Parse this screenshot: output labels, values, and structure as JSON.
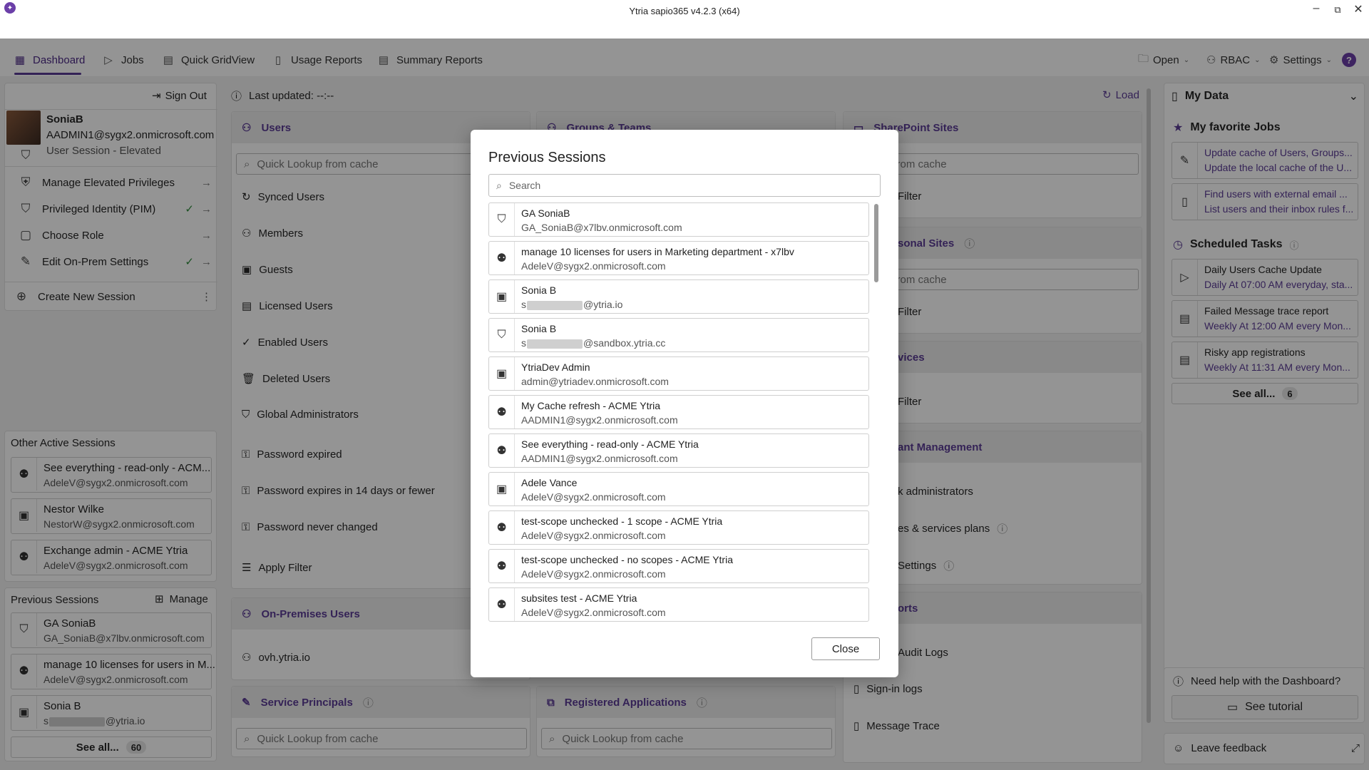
{
  "window": {
    "title": "Ytria sapio365 v4.2.3 (x64)",
    "minimize": "–",
    "restore": "⧉",
    "close": "✕"
  },
  "tabs": [
    {
      "label": "Dashboard",
      "icon": "▦"
    },
    {
      "label": "Jobs",
      "icon": "▷"
    },
    {
      "label": "Quick GridView",
      "icon": "▤"
    },
    {
      "label": "Usage Reports",
      "icon": "▯"
    },
    {
      "label": "Summary Reports",
      "icon": "▤"
    }
  ],
  "toolbar": {
    "open": "Open",
    "rbac": "RBAC",
    "settings": "Settings",
    "help": "?"
  },
  "session": {
    "sign_out": "Sign Out",
    "name": "SoniaB",
    "email": "AADMIN1@sygx2.onmicrosoft.com",
    "type": "User Session - Elevated",
    "actions": [
      {
        "label": "Manage Elevated Privileges",
        "check": false
      },
      {
        "label": "Privileged Identity (PIM)",
        "check": true
      },
      {
        "label": "Choose Role",
        "check": false
      },
      {
        "label": "Edit On-Prem Settings",
        "check": true
      }
    ],
    "create": "Create New Session"
  },
  "other_sessions": {
    "title": "Other Active Sessions",
    "items": [
      {
        "name": "See everything - read-only - ACM...",
        "email": "AdeleV@sygx2.onmicrosoft.com"
      },
      {
        "name": "Nestor Wilke",
        "email": "NestorW@sygx2.onmicrosoft.com"
      },
      {
        "name": "Exchange admin - ACME Ytria",
        "email": "AdeleV@sygx2.onmicrosoft.com"
      }
    ]
  },
  "prev_sessions_side": {
    "title": "Previous Sessions",
    "manage": "Manage",
    "items": [
      {
        "name": "GA SoniaB",
        "email": "GA_SoniaB@x7lbv.onmicrosoft.com"
      },
      {
        "name": "manage 10 licenses for users in M...",
        "email": "AdeleV@sygx2.onmicrosoft.com"
      },
      {
        "name": "Sonia B",
        "email_prefix": "s",
        "email_suffix": "@ytria.io"
      }
    ],
    "see_all": "See all...",
    "count": "60"
  },
  "top": {
    "last_updated": "Last updated: --:--",
    "load": "Load"
  },
  "users_card": {
    "title": "Users",
    "lookup": "Quick Lookup from cache",
    "items": [
      "Synced Users",
      "Members",
      "Guests",
      "Licensed Users",
      "Enabled Users",
      "Deleted Users",
      "Global Administrators",
      "Password expired",
      "Password expires in 14 days or fewer",
      "Password never changed",
      "Apply Filter"
    ]
  },
  "groups_card": {
    "title": "Groups & Teams"
  },
  "onprem_card": {
    "title": "On-Premises Users",
    "item": "ovh.ytria.io"
  },
  "sp_card": {
    "title": "Service Principals",
    "lookup": "Quick Lookup from cache"
  },
  "apps_card": {
    "title": "Registered Applications",
    "lookup": "Quick Lookup from cache"
  },
  "right_col": {
    "sharepoint": "SharePoint Sites",
    "lookup": "Lookup from cache",
    "filter": "Filter",
    "personal": "sonal Sites",
    "vices": "vices",
    "tenant": "ant Management",
    "admins": "k administrators",
    "plans": "es & services plans",
    "settings": "Settings",
    "reports": "orts",
    "audit": "Audit Logs",
    "signin": "Sign-in logs",
    "trace": "Message Trace"
  },
  "mydata": {
    "title": "My Data",
    "fav_title": "My favorite Jobs",
    "favs": [
      {
        "title": "Update cache of Users, Groups...",
        "desc": "Update the local cache of the U..."
      },
      {
        "title": "Find users with external email ...",
        "desc": "List users and their inbox rules f..."
      }
    ],
    "sched_title": "Scheduled Tasks",
    "tasks": [
      {
        "title": "Daily Users Cache Update",
        "when": "Daily At 07:00 AM everyday, sta..."
      },
      {
        "title": "Failed Message trace report",
        "when": "Weekly At 12:00 AM every Mon..."
      },
      {
        "title": "Risky app registrations",
        "when": "Weekly At 11:31 AM every Mon..."
      }
    ],
    "see_all": "See all...",
    "count": "6",
    "help": "Need help with the Dashboard?",
    "tutorial": "See tutorial",
    "feedback": "Leave feedback"
  },
  "dialog": {
    "title": "Previous Sessions",
    "search_placeholder": "Search",
    "close": "Close",
    "rows": [
      {
        "title": "GA SoniaB",
        "sub": "GA_SoniaB@x7lbv.onmicrosoft.com",
        "icon": "shield-user-icon"
      },
      {
        "title": "manage 10 licenses for users in Marketing department - x7lbv",
        "sub": "AdeleV@sygx2.onmicrosoft.com",
        "icon": "role-user-icon"
      },
      {
        "title": "Sonia B",
        "sub_prefix": "s",
        "sub_suffix": "@ytria.io",
        "icon": "badge-user-icon"
      },
      {
        "title": "Sonia B",
        "sub_prefix": "s",
        "sub_suffix": "@sandbox.ytria.cc",
        "icon": "shield-user-icon"
      },
      {
        "title": "YtriaDev Admin",
        "sub": "admin@ytriadev.onmicrosoft.com",
        "icon": "badge-user-icon"
      },
      {
        "title": "My Cache refresh - ACME Ytria",
        "sub": "AADMIN1@sygx2.onmicrosoft.com",
        "icon": "role-user-icon"
      },
      {
        "title": "See everything - read-only - ACME Ytria",
        "sub": "AADMIN1@sygx2.onmicrosoft.com",
        "icon": "role-user-icon"
      },
      {
        "title": "Adele Vance",
        "sub": "AdeleV@sygx2.onmicrosoft.com",
        "icon": "badge-user-icon"
      },
      {
        "title": "test-scope unchecked - 1 scope - ACME Ytria",
        "sub": "AdeleV@sygx2.onmicrosoft.com",
        "icon": "role-user-icon"
      },
      {
        "title": "test-scope unchecked - no scopes - ACME Ytria",
        "sub": "AdeleV@sygx2.onmicrosoft.com",
        "icon": "role-user-icon"
      },
      {
        "title": "subsites test - ACME Ytria",
        "sub": "AdeleV@sygx2.onmicrosoft.com",
        "icon": "role-user-icon"
      }
    ]
  },
  "colors": {
    "accent": "#5b3b95",
    "overlay": "rgba(0,0,0,0.42)",
    "check": "#2e8b3a"
  }
}
